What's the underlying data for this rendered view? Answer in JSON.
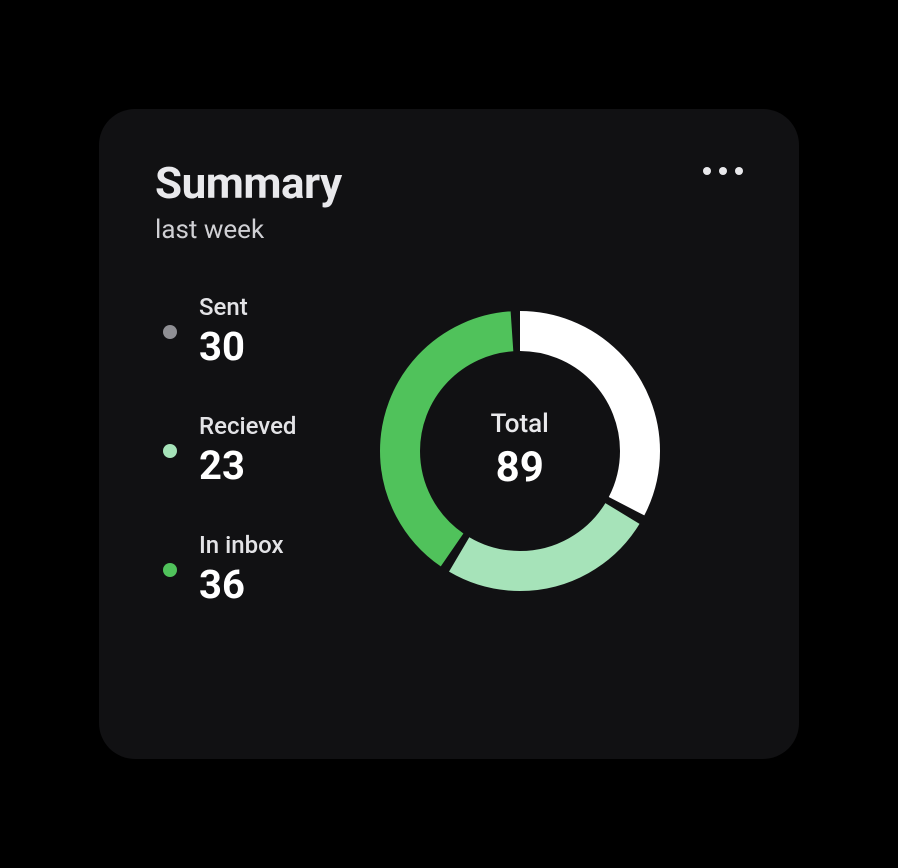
{
  "card": {
    "title": "Summary",
    "subtitle": "last week",
    "total_label": "Total",
    "total_value": "89"
  },
  "legend": [
    {
      "label": "Sent",
      "value": "30",
      "color": "#8f8f94"
    },
    {
      "label": "Recieved",
      "value": "23",
      "color": "#a6e3b9"
    },
    {
      "label": "In inbox",
      "value": "36",
      "color": "#50c25b"
    }
  ],
  "chart_data": {
    "type": "pie",
    "title": "Summary — last week",
    "categories": [
      "Sent",
      "Recieved",
      "In inbox"
    ],
    "values": [
      30,
      23,
      36
    ],
    "colors": [
      "#ffffff",
      "#a6e3b9",
      "#50c25b"
    ],
    "total_label": "Total",
    "total": 89
  }
}
